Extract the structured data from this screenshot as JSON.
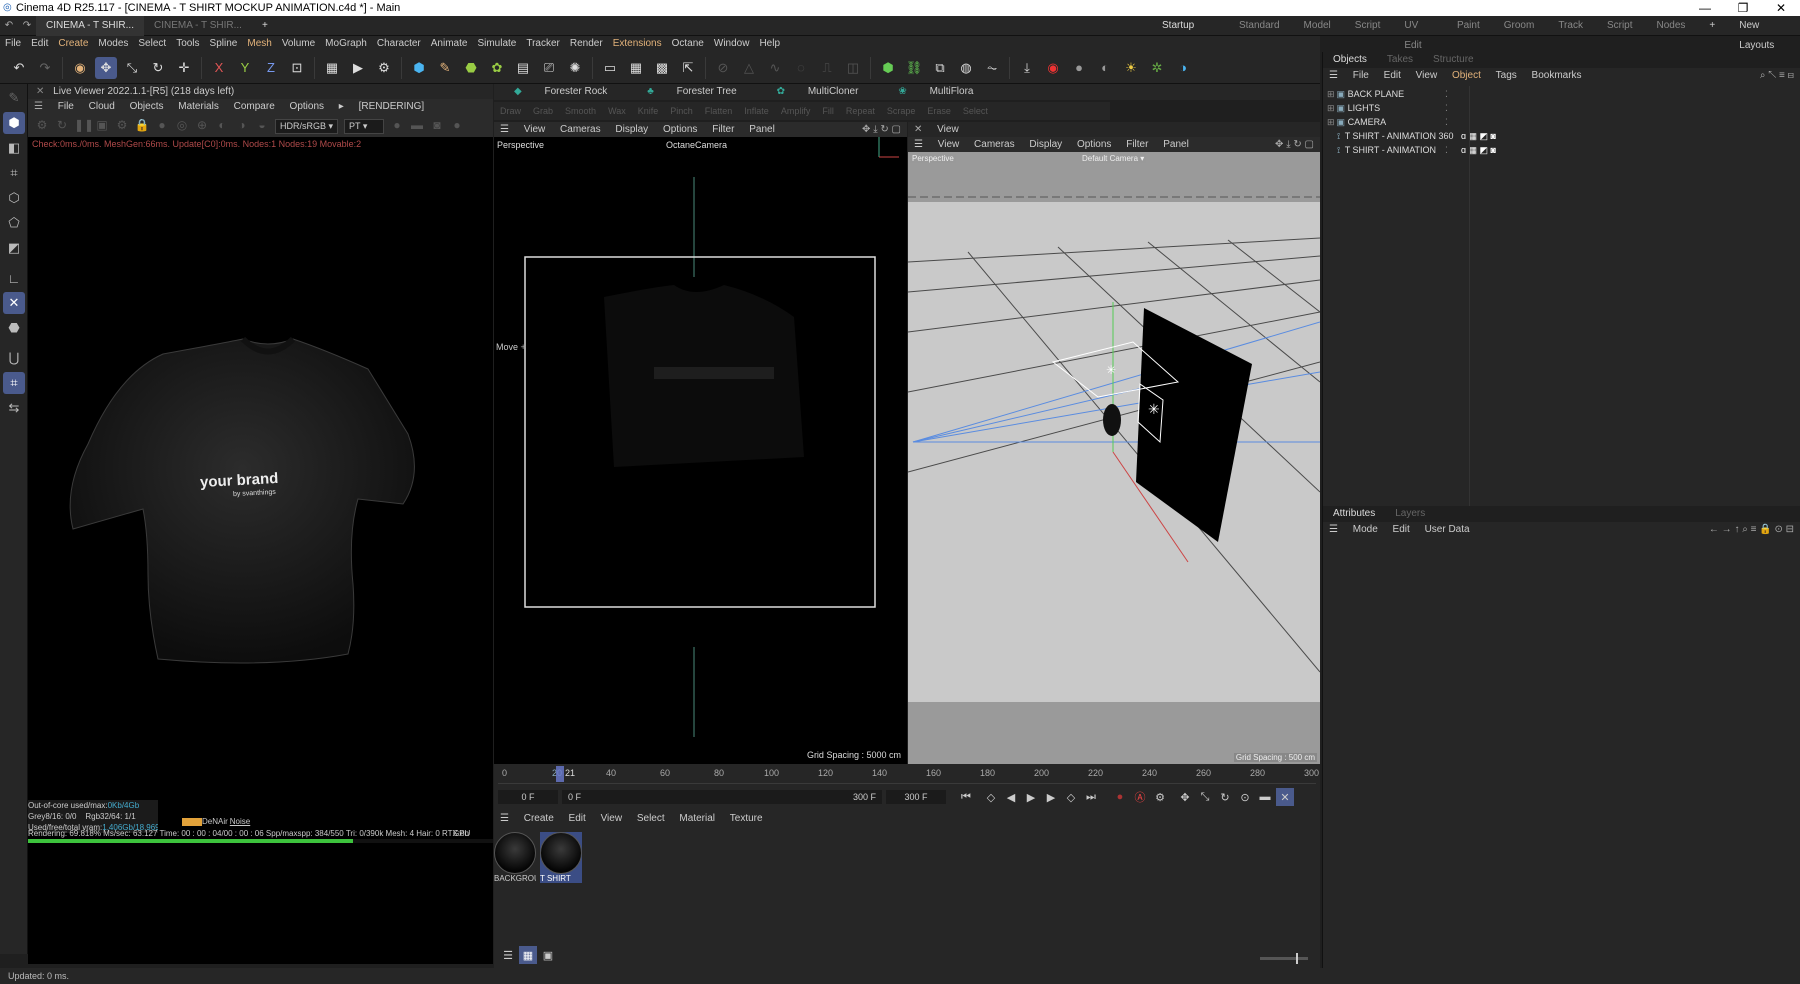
{
  "window": {
    "title": "Cinema 4D R25.117 - [CINEMA - T SHIRT MOCKUP ANIMATION.c4d *] - Main",
    "controls": [
      "—",
      "❐",
      "✕"
    ]
  },
  "tabs": {
    "doc_tabs": [
      "CINEMA - T SHIR...",
      "CINEMA - T SHIR..."
    ],
    "add_tab": "+",
    "layouts": [
      "Startup (User)",
      "Standard",
      "Model",
      "Script",
      "UV Edit",
      "Paint",
      "Groom",
      "Track",
      "Script",
      "Nodes"
    ],
    "new_layouts": "New Layouts"
  },
  "menu": [
    "File",
    "Edit",
    "Create",
    "Modes",
    "Select",
    "Tools",
    "Spline",
    "Mesh",
    "Volume",
    "MoGraph",
    "Character",
    "Animate",
    "Simulate",
    "Tracker",
    "Render",
    "Extensions",
    "Octane",
    "Window",
    "Help"
  ],
  "live_viewer": {
    "title": "Live Viewer 2022.1.1-[R5] (218 days left)",
    "menu": [
      "File",
      "Cloud",
      "Objects",
      "Materials",
      "Compare",
      "Options"
    ],
    "status": "[RENDERING]",
    "color_space": "HDR/sRGB",
    "kernel": "PT",
    "stats_line": "Check:0ms./0ms. MeshGen:66ms. Update[C0]:0ms. Nodes:1 Nodes:19 Movable:2",
    "shirt_text": "your brand",
    "shirt_subtext": "by svanthings",
    "bottom": {
      "ooc": "Out-of-core used/max:",
      "ooc_val": "0Kb/4Gb",
      "grey": "Grey8/16: 0/0",
      "rgb": "Rgb32/64: 1/1",
      "vram": "Used/free/total vram:",
      "vram_val": "1.406Gb/18.969Gb/23.9...",
      "devices": "DeNAir",
      "noise": "Noise",
      "rendering": "Rendering: 69.818%  Ms/sec: 63.127   Time: 00 : 00 : 04/00 : 00 : 06   Spp/maxspp: 384/550   Tri: 0/390k   Mesh: 4   Hair: 0   RTX:on",
      "gpu": "GPU",
      "progress": 0.698
    }
  },
  "forester": {
    "items": [
      "Forester Rock",
      "Forester Tree",
      "MultiCloner",
      "MultiFlora"
    ]
  },
  "disabled_tools": [
    "Draw",
    "Grab",
    "Smooth",
    "Wax",
    "Knife",
    "Pinch",
    "Flatten",
    "Inflate",
    "Amplify",
    "Fill",
    "Repeat",
    "Scrape",
    "Erase",
    "Select"
  ],
  "viewport_left": {
    "menu": [
      "View",
      "Cameras",
      "Display",
      "Options",
      "Filter",
      "Panel"
    ],
    "label": "Perspective",
    "camera": "OctaneCamera",
    "move_label": "Move",
    "grid_spacing": "Grid Spacing : 5000 cm"
  },
  "viewport_right": {
    "header": "View",
    "menu": [
      "View",
      "Cameras",
      "Display",
      "Options",
      "Filter",
      "Panel"
    ],
    "label": "Perspective",
    "camera": "Default Camera",
    "grid_spacing": "Grid Spacing : 500 cm"
  },
  "timeline": {
    "ticks": [
      "0",
      "20",
      "40",
      "60",
      "80",
      "100",
      "120",
      "140",
      "160",
      "180",
      "200",
      "220",
      "240",
      "260",
      "280",
      "300"
    ],
    "current_frame": "21",
    "start_field": "0 F",
    "preview_start": "0 F",
    "preview_end": "300 F",
    "end_field": "300 F"
  },
  "materials": {
    "menu": [
      "Create",
      "Edit",
      "View",
      "Select",
      "Material",
      "Texture"
    ],
    "items": [
      "BACKGROU",
      "T SHIRT"
    ]
  },
  "objects": {
    "tabs": [
      "Objects",
      "Takes",
      "Structure"
    ],
    "menu": [
      "File",
      "Edit",
      "View",
      "Object",
      "Tags",
      "Bookmarks"
    ],
    "rows": [
      "BACK PLANE",
      "LIGHTS",
      "CAMERA",
      "T SHIRT - ANIMATION 360",
      "T SHIRT - ANIMATION"
    ]
  },
  "attributes": {
    "tabs": [
      "Attributes",
      "Layers"
    ],
    "menu": [
      "Mode",
      "Edit",
      "User Data"
    ]
  },
  "status": "Updated: 0 ms."
}
